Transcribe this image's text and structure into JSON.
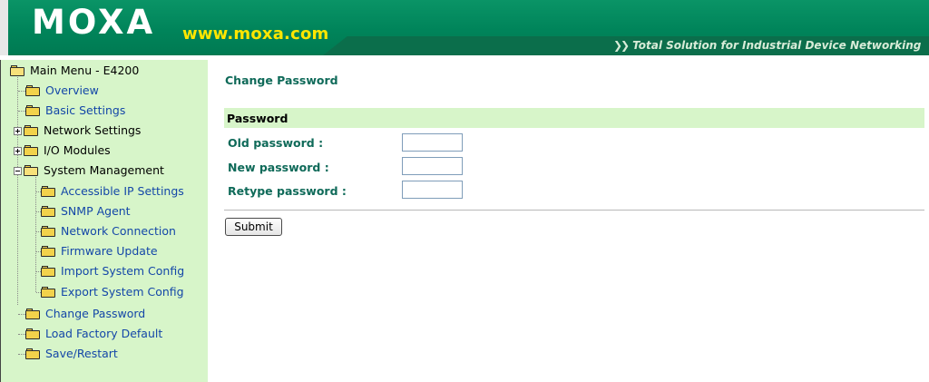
{
  "header": {
    "logo_text": "MOXA",
    "url_text": "www.moxa.com",
    "tagline": "Total Solution for Industrial Device Networking",
    "tagline_icon": "chevrons-right-icon",
    "colors": {
      "header_green": "#00845a",
      "url_yellow": "#ffe600",
      "tagline_strip": "#0b6e4b"
    }
  },
  "sidebar": {
    "root": {
      "label": "Main Menu - E4200",
      "icon": "folder-open-icon"
    },
    "items": [
      {
        "label": "Overview",
        "type": "link",
        "icon": "folder-icon"
      },
      {
        "label": "Basic Settings",
        "type": "link",
        "icon": "folder-icon"
      },
      {
        "label": "Network Settings",
        "type": "group",
        "expander": "plus",
        "icon": "folder-icon"
      },
      {
        "label": "I/O Modules",
        "type": "group",
        "expander": "plus",
        "icon": "folder-icon"
      },
      {
        "label": "System Management",
        "type": "group",
        "expander": "minus",
        "icon": "folder-open-icon",
        "children": [
          {
            "label": "Accessible IP Settings",
            "icon": "folder-icon"
          },
          {
            "label": "SNMP Agent",
            "icon": "folder-icon"
          },
          {
            "label": "Network Connection",
            "icon": "folder-icon"
          },
          {
            "label": "Firmware Update",
            "icon": "folder-icon"
          },
          {
            "label": "Import System Config",
            "icon": "folder-icon"
          },
          {
            "label": "Export System Config",
            "icon": "folder-icon"
          }
        ]
      },
      {
        "label": "Change Password",
        "type": "link",
        "icon": "folder-icon"
      },
      {
        "label": "Load Factory Default",
        "type": "link",
        "icon": "folder-icon"
      },
      {
        "label": "Save/Restart",
        "type": "link",
        "icon": "folder-icon"
      }
    ],
    "colors": {
      "background": "#d7f5c9",
      "link": "#1447a8"
    }
  },
  "main": {
    "title": "Change Password",
    "section": "Password",
    "fields": [
      {
        "label": "Old password :",
        "value": ""
      },
      {
        "label": "New password :",
        "value": ""
      },
      {
        "label": "Retype password :",
        "value": ""
      }
    ],
    "submit_label": "Submit",
    "colors": {
      "label_green": "#0f6a59",
      "section_bg": "#d7f5c9"
    }
  }
}
